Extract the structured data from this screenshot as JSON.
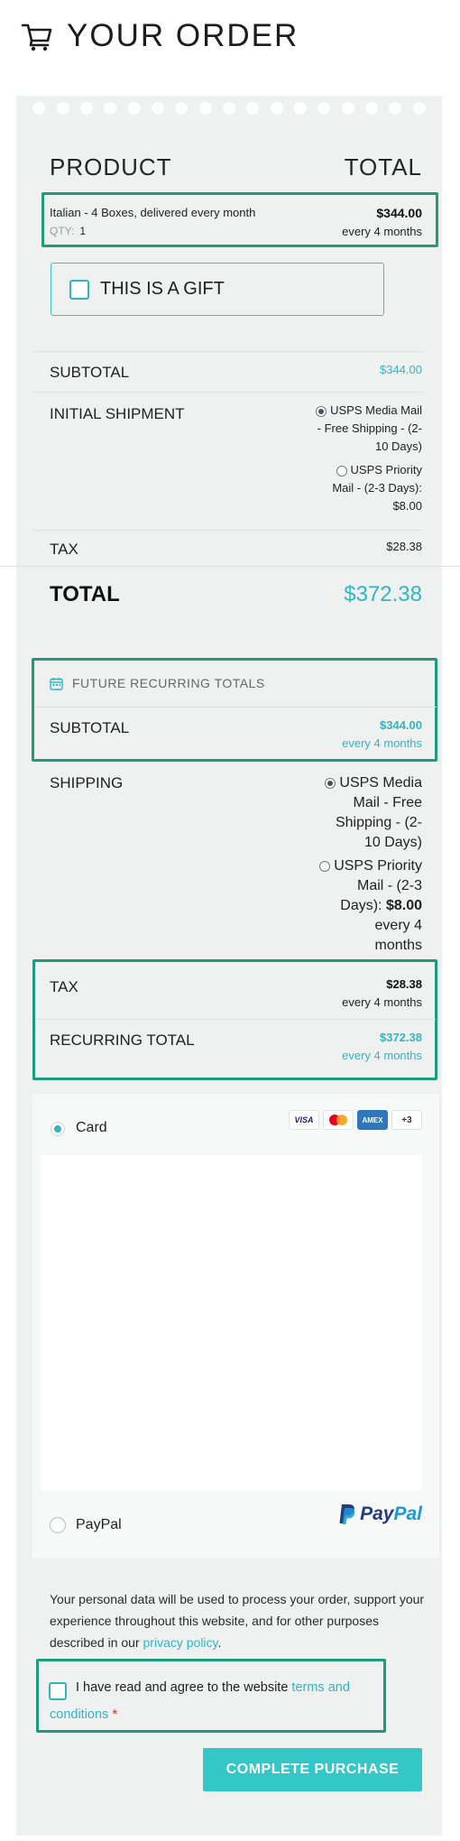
{
  "header": {
    "title": "YOUR ORDER",
    "icon": "cart-icon"
  },
  "order_table": {
    "col_product": "PRODUCT",
    "col_total": "TOTAL",
    "item": {
      "name": "Italian - 4 Boxes, delivered every month",
      "qty_label": "QTY:",
      "qty": "1",
      "price": "$344.00",
      "frequency": "every 4 months"
    },
    "gift_label": "THIS IS A GIFT"
  },
  "summary": {
    "subtotal_label": "SUBTOTAL",
    "subtotal_value": "$344.00",
    "initial_shipment_label": "INITIAL SHIPMENT",
    "shipping_options": [
      {
        "label": "USPS Media Mail - Free Shipping - (2-10 Days)",
        "line1": "USPS Media Mail",
        "line2": "- Free Shipping - (2-",
        "line3": "10 Days)",
        "selected": true
      },
      {
        "label": "USPS Priority Mail - (2-3 Days): $8.00",
        "line1": "USPS Priority",
        "line2": "Mail - (2-3 Days):",
        "line3": "$8.00",
        "selected": false
      }
    ],
    "tax_label": "TAX",
    "tax_value": "$28.38",
    "total_label": "TOTAL",
    "total_value": "$372.38"
  },
  "recurring": {
    "heading": "FUTURE RECURRING TOTALS",
    "subtotal_label": "SUBTOTAL",
    "subtotal_value": "$344.00",
    "subtotal_freq": "every 4 months",
    "shipping_label": "SHIPPING",
    "shipping_options": [
      {
        "l1": "USPS Media",
        "l2": "Mail - Free",
        "l3": "Shipping - (2-",
        "l4": "10 Days)",
        "selected": true
      },
      {
        "l1": "USPS Priority",
        "l2": "Mail - (2-3",
        "l3": "Days):",
        "price": "$8.00",
        "l4": "every 4",
        "l5": "months",
        "selected": false
      }
    ],
    "tax_label": "TAX",
    "tax_value": "$28.38",
    "tax_freq": "every 4 months",
    "total_label": "RECURRING TOTAL",
    "total_value": "$372.38",
    "total_freq": "every 4 months"
  },
  "payment": {
    "card_label": "Card",
    "card_brands": [
      "VISA",
      "MC",
      "AMEX",
      "+3"
    ],
    "paypal_label": "PayPal",
    "paypal_logo": {
      "pay": "Pay",
      "pal": "Pal"
    }
  },
  "privacy": {
    "text": "Your personal data will be used to process your order, support your experience throughout this website, and for other purposes described in our ",
    "link": "privacy policy",
    "end": "."
  },
  "terms": {
    "text": "I have read and agree to the website ",
    "link_part1": "terms and",
    "link_part2": "conditions",
    "required": "*"
  },
  "button": {
    "complete": "COMPLETE PURCHASE"
  },
  "colors": {
    "accent": "#33b5c0",
    "button": "#33c7c7",
    "highlight": "#1e9b7d",
    "panel": "#eff1f0"
  }
}
